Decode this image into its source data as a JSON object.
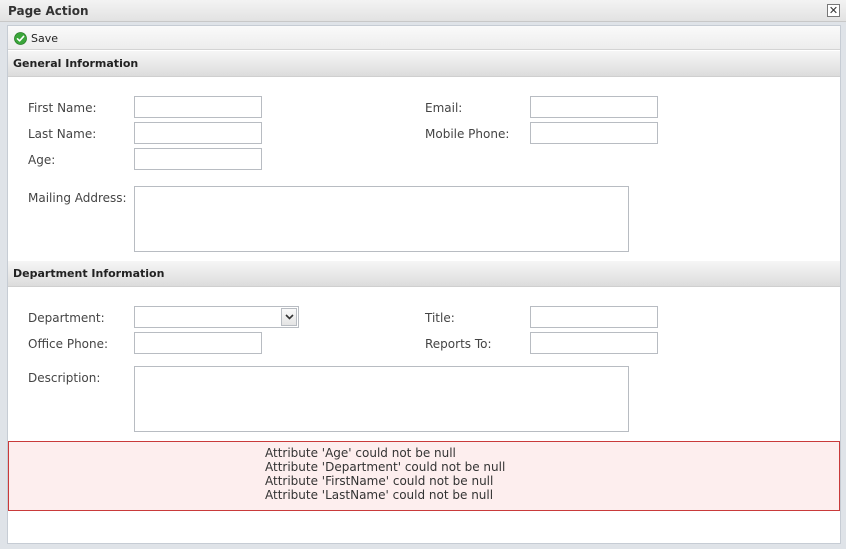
{
  "window": {
    "title": "Page Action",
    "close_symbol": "✕"
  },
  "toolbar": {
    "save_label": "Save",
    "save_icon": "check-circle-icon"
  },
  "general": {
    "header": "General Information",
    "first_name_label": "First Name:",
    "first_name_value": "",
    "last_name_label": "Last Name:",
    "last_name_value": "",
    "age_label": "Age:",
    "age_value": "",
    "email_label": "Email:",
    "email_value": "",
    "mobile_label": "Mobile Phone:",
    "mobile_value": "",
    "address_label": "Mailing Address:",
    "address_value": ""
  },
  "department": {
    "header": "Department Information",
    "department_label": "Department:",
    "department_value": "",
    "title_label": "Title:",
    "title_value": "",
    "office_phone_label": "Office Phone:",
    "office_phone_value": "",
    "reports_to_label": "Reports To:",
    "reports_to_value": "",
    "description_label": "Description:",
    "description_value": ""
  },
  "errors": [
    "Attribute 'Age' could not be null",
    "Attribute 'Department' could not be null",
    "Attribute 'FirstName' could not be null",
    "Attribute 'LastName' could not be null"
  ],
  "colors": {
    "error_bg": "#fdeeee",
    "error_border": "#c93a3a",
    "save_icon_green": "#3aa63a"
  }
}
